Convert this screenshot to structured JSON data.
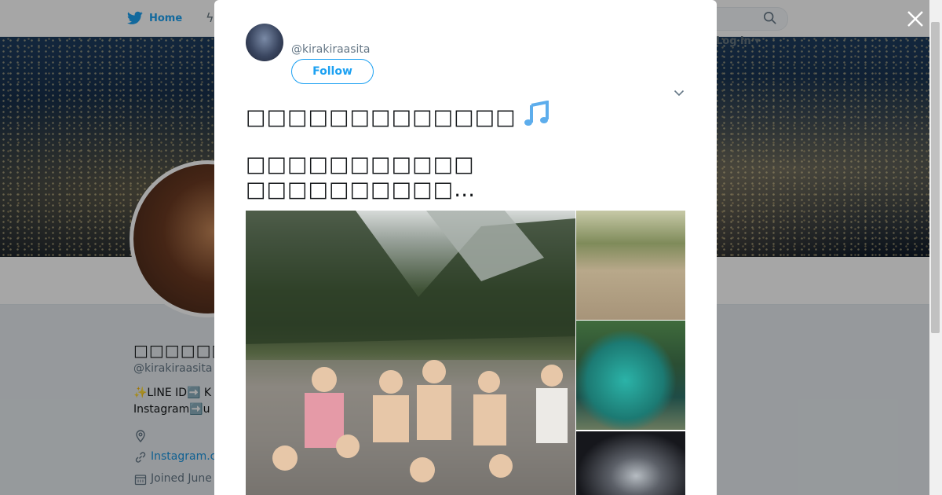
{
  "nav": {
    "home_label": "Home",
    "search_placeholder": "",
    "login_label": "Log in"
  },
  "profile": {
    "name": "□□□□□□□□",
    "handle": "@kirakiraasita",
    "bio_line1": "✨LINE ID➡️ K",
    "bio_line2": "Instagram➡️u",
    "link_text": "Instagram.c",
    "joined": "Joined June"
  },
  "tweet": {
    "handle": "@kirakiraasita",
    "follow_label": "Follow",
    "line1": "□□□□□□□□□□□□□",
    "line2": "□□□□□□□□□□□",
    "line3": "□□□□□□□□□□…"
  },
  "colors": {
    "accent": "#1da1f2",
    "link": "#1b95e0"
  },
  "icons": {
    "home": "twitter-bird-icon",
    "search": "search-icon",
    "close": "close-icon",
    "caret": "chevron-down-icon",
    "music": "musical-notes-icon",
    "location": "location-pin-icon",
    "link": "link-icon",
    "calendar": "calendar-icon"
  }
}
